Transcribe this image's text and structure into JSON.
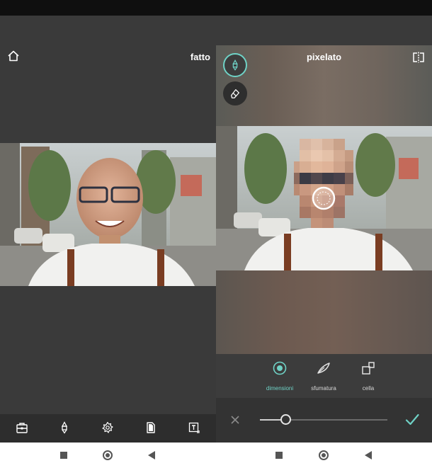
{
  "left_screen": {
    "header": {
      "home_icon": "home-icon",
      "done_label": "fatto"
    },
    "toolbar": {
      "icons": [
        "toolbox-icon",
        "brush-icon",
        "effects-icon",
        "sticker-icon",
        "text-icon"
      ]
    }
  },
  "right_screen": {
    "title": "pixelato",
    "compare_icon": "compare-icon",
    "brush_icon": "brush-icon",
    "eraser_icon": "eraser-icon",
    "options": [
      {
        "label": "dimensioni",
        "icon": "size-icon",
        "active": true
      },
      {
        "label": "sfumatura",
        "icon": "feather-icon",
        "active": false
      },
      {
        "label": "cella",
        "icon": "cell-icon",
        "active": false
      }
    ],
    "slider": {
      "value": 0.2
    },
    "cancel_icon": "close-icon",
    "apply_icon": "check-icon"
  },
  "colors": {
    "accent": "#6fd2c6",
    "panel": "#3a3a3a",
    "toolbar": "#2d2d2d"
  },
  "navbar": {
    "icons": [
      "square-icon",
      "circle-icon",
      "back-triangle-icon"
    ]
  }
}
